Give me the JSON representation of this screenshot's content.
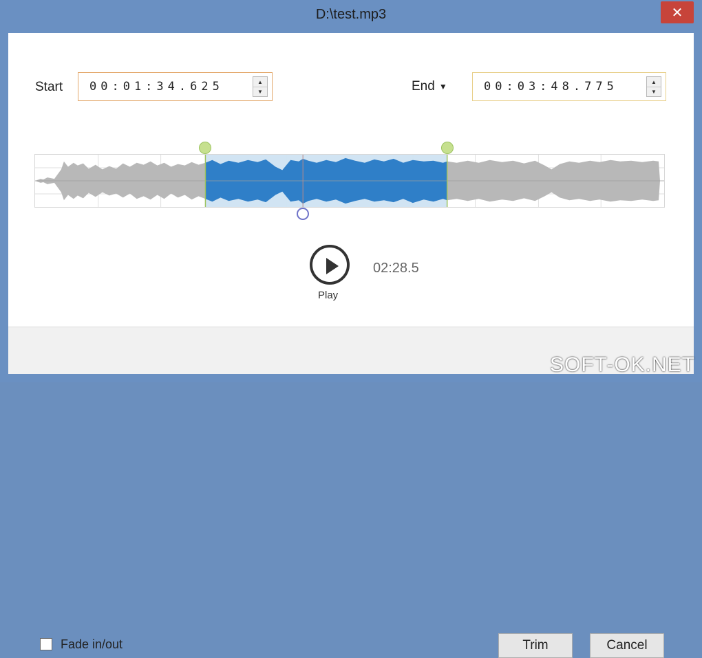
{
  "window": {
    "title": "D:\\test.mp3",
    "close_label": "✕"
  },
  "trim": {
    "start_label": "Start",
    "start_value": "00:01:34.625",
    "end_label": "End",
    "end_value": "00:03:48.775"
  },
  "player": {
    "play_label": "Play",
    "time": "02:28.5"
  },
  "footer": {
    "fade_label": "Fade in/out",
    "trim_button": "Trim",
    "cancel_button": "Cancel"
  },
  "watermark": "SOFT-OK.NET",
  "icons": {
    "play": "play-icon",
    "close": "close-icon",
    "dropdown": "chevron-down-icon"
  },
  "colors": {
    "accent": "#2f7fc8",
    "selection": "#cfe3f2",
    "wave_gray": "#b8b8b8",
    "marker": "#c6e08f"
  }
}
